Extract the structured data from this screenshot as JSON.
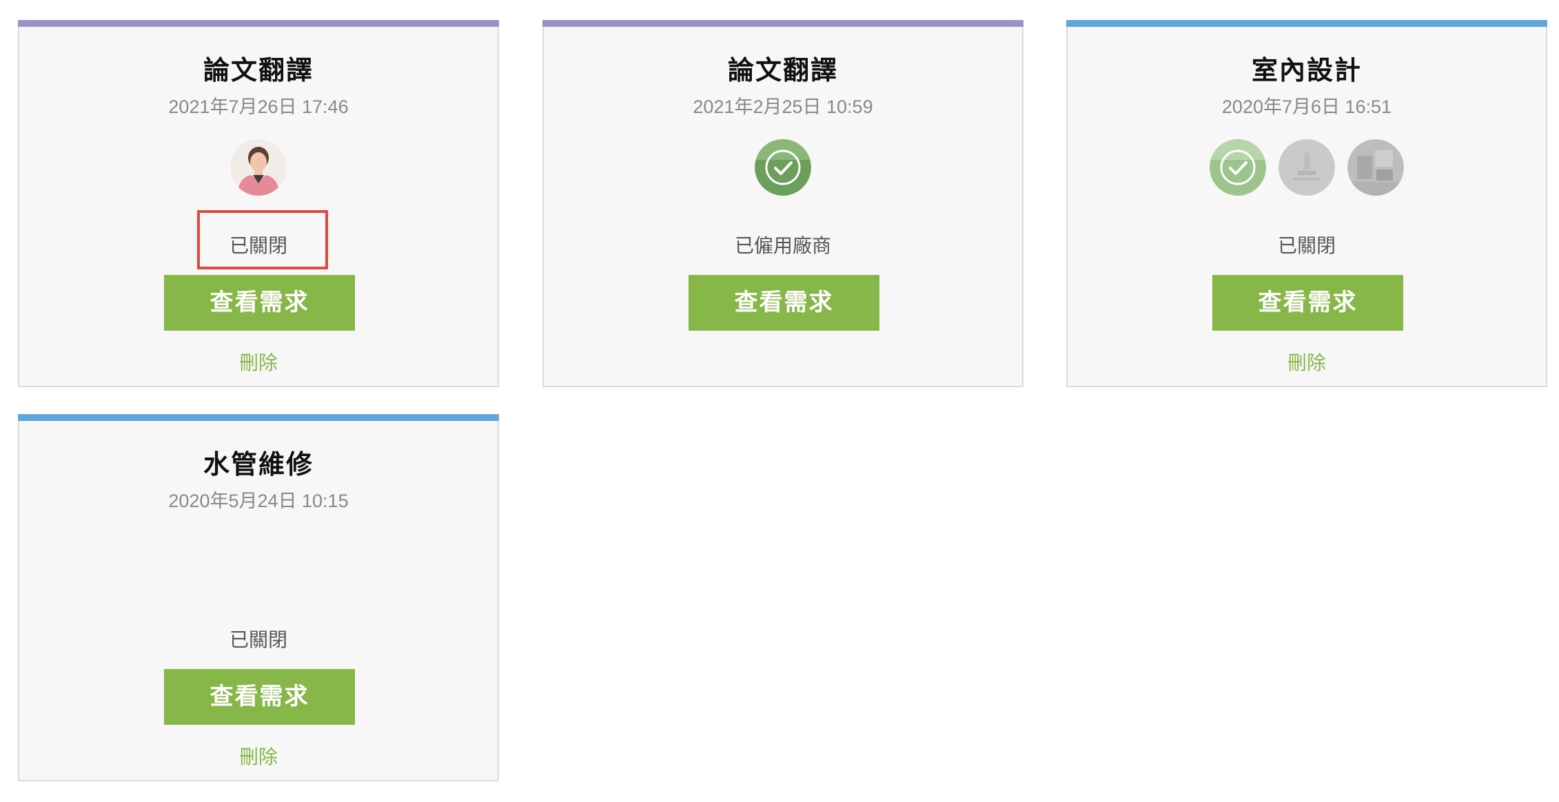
{
  "cards": [
    {
      "title": "論文翻譯",
      "date": "2021年7月26日 17:46",
      "status": "已關閉",
      "view_label": "查看需求",
      "delete_label": "刪除",
      "accent": "#9b93c6",
      "avatars": [
        "person-photo"
      ]
    },
    {
      "title": "論文翻譯",
      "date": "2021年2月25日 10:59",
      "status": "已僱用廠商",
      "view_label": "查看需求",
      "accent": "#9b93c6",
      "avatars": [
        "check-icon"
      ]
    },
    {
      "title": "室內設計",
      "date": "2020年7月6日 16:51",
      "status": "已關閉",
      "view_label": "查看需求",
      "delete_label": "刪除",
      "accent": "#5fa7db",
      "avatars": [
        "check-icon",
        "vendor-photo",
        "vendor-photo"
      ]
    },
    {
      "title": "水管維修",
      "date": "2020年5月24日 10:15",
      "status": "已關閉",
      "view_label": "查看需求",
      "delete_label": "刪除",
      "accent": "#5fa7db",
      "avatars": []
    }
  ],
  "colors": {
    "button": "#87b748",
    "highlight": "#e0473a"
  }
}
